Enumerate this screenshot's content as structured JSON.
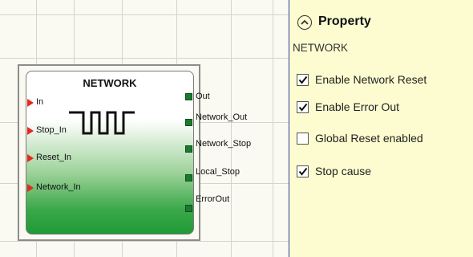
{
  "block": {
    "title": "NETWORK",
    "inputs": [
      "In",
      "Stop_In",
      "Reset_In",
      "Network_In"
    ],
    "outputs": [
      "Out",
      "Network_Out",
      "Network_Stop",
      "Local_Stop",
      "ErrorOut"
    ],
    "icon": "square-wave-icon",
    "colors": {
      "input_pin": "#e8251f",
      "output_pin": "#1a7a2e",
      "body_gradient_bottom": "#1f9a36"
    }
  },
  "property_panel": {
    "title": "Property",
    "subtitle": "NETWORK",
    "collapse_icon": "chevron-up-circle-icon",
    "items": [
      {
        "label": "Enable Network Reset",
        "checked": true
      },
      {
        "label": "Enable Error Out",
        "checked": true
      },
      {
        "label": "Global Reset enabled",
        "checked": false
      },
      {
        "label": "Stop cause",
        "checked": true
      }
    ]
  }
}
